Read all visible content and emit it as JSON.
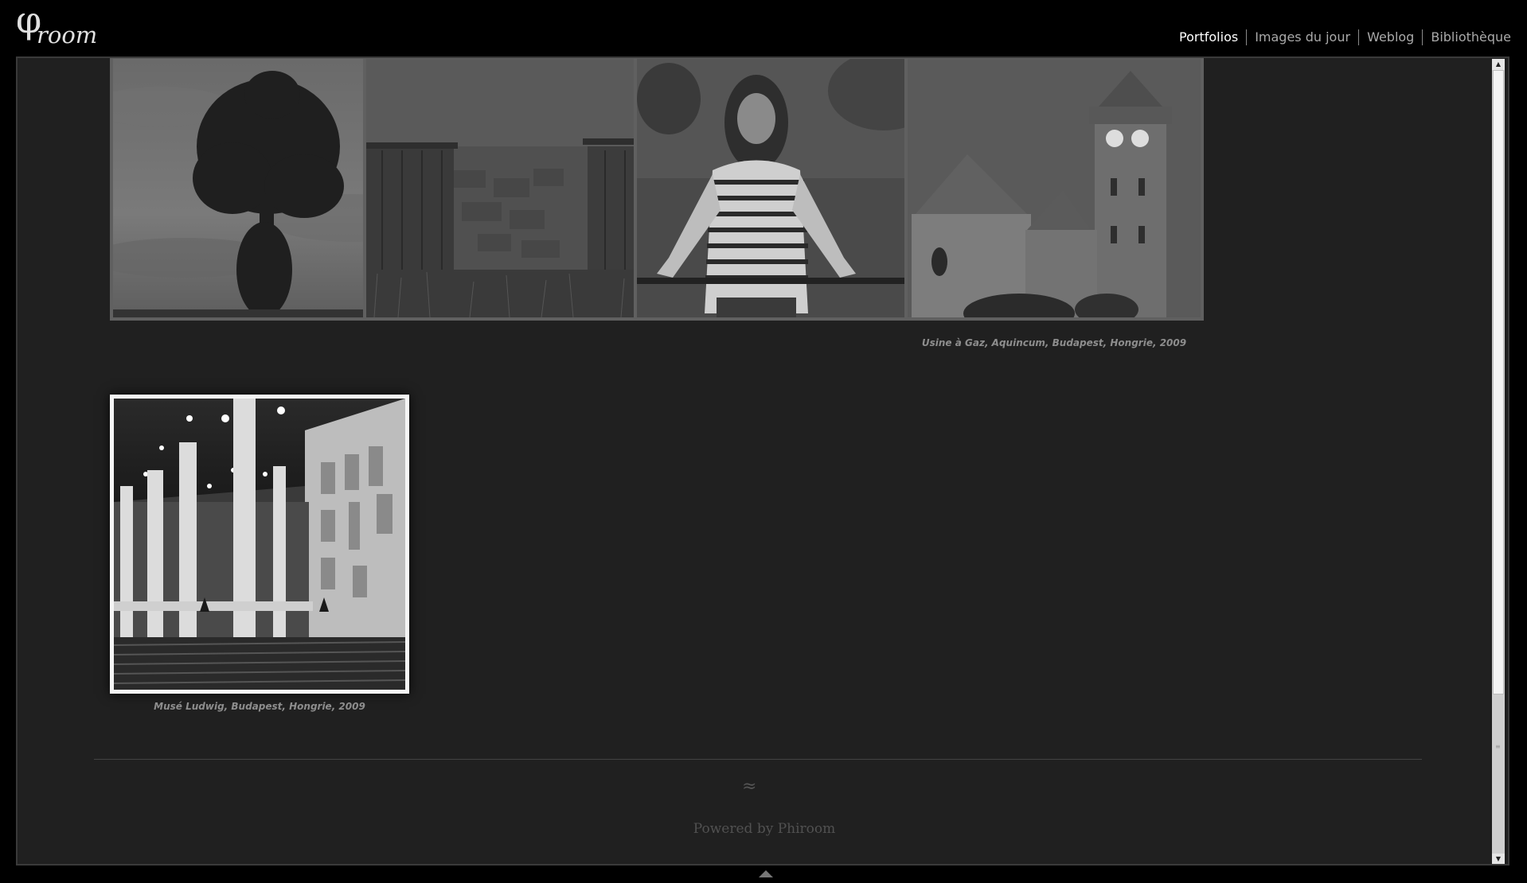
{
  "brand": {
    "symbol": "φ",
    "wordmark": "room"
  },
  "nav": {
    "items": [
      "Portfolios",
      "Images du jour",
      "Weblog",
      "Bibliothèque"
    ]
  },
  "gallery": {
    "captions": {
      "usine": "Usine à Gaz, Aquincum, Budapest, Hongrie, 2009",
      "ludwig": "Musé Ludwig, Budapest, Hongrie, 2009"
    }
  },
  "footer": {
    "ornament": "≈",
    "powered": "Powered by Phiroom"
  }
}
